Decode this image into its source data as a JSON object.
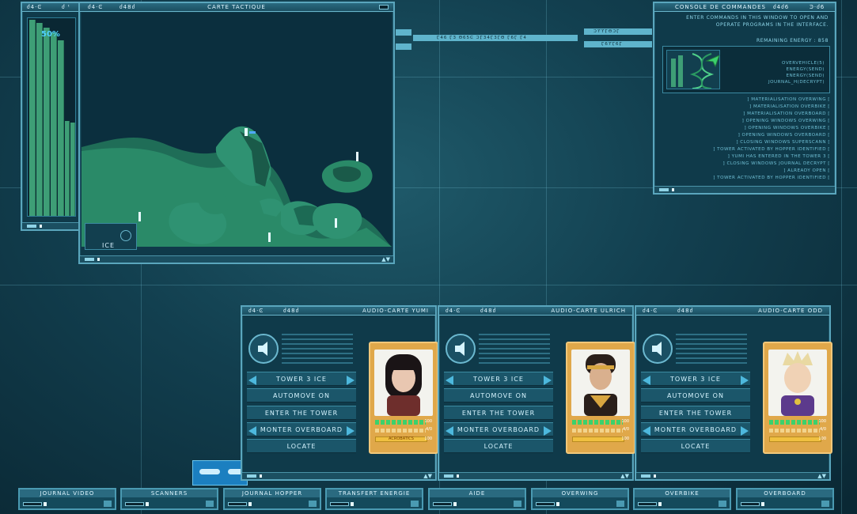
{
  "energy_panel": {
    "codes": [
      "ძ4·Ͼ",
      "ძ ᵗ"
    ],
    "energy_value": "50%",
    "energy_fraction": 0.5
  },
  "map": {
    "title": "CARTE TACTIQUE",
    "codes": [
      "ძ4·Ͼ",
      "ძ48ძ"
    ],
    "sector_label": "ICE"
  },
  "connector": {
    "center_label": "Ӷ46 Ӷ3 ϑ65Ͼ ϽӶ34Ӷ3Ӷϑ Ӷ6Ӷ Ӷ4",
    "right_top": "ϽϒϒӶϑϽӶ",
    "right_bottom": "Ӷ6ϒӶ6Ӷ"
  },
  "console": {
    "title": "CONSOLE DE COMMANDES",
    "codes": [
      "ძ4ძ6",
      "Ͽ·ძ6"
    ],
    "intro": "ENTER COMMANDS IN THIS WINDOW TO OPEN AND OPERATE PROGRAMS IN THE INTERFACE.",
    "intro_line1": "ENTER COMMANDS IN THIS WINDOW TO OPEN AND",
    "intro_line2": "OPERATE PROGRAMS IN THE INTERFACE.",
    "remaining_energy": "REMAINING ENERGY : 858",
    "programs": [
      "OVERVEHICLE(5)",
      "ENERGY(SEND)",
      "ENERGY(SEND)",
      "JOURNAL_H(DECRYPT)"
    ],
    "log": [
      "] MATERIALISATION OVERWING [",
      "] MATERIALISATION OVERBIKE [",
      "] MATERIALISATION OVERBOARD [",
      "] OPENING WINDOWS OVERWING [",
      "] OPENING WINDOWS OVERBIKE [",
      "] OPENING WINDOWS OVERBOARD [",
      "] CLOSING WINDOWS SUPERSCANN [",
      "] TOWER ACTIVATED BY HOPPER IDENTIFIED [",
      "] YUMI HAS ENTERED IN THE TOWER 3 [",
      "] CLOSING WINDOWS JOURNAL DECRYPT [",
      "] ALREADY OPEN [",
      "] TOWER ACTIVATED BY HOPPER IDENTIFIED ["
    ]
  },
  "cards": [
    {
      "title": "AUDIO-CARTE YUMI",
      "codes": [
        "ძ4·Ͼ",
        "ძ48ძ"
      ],
      "tower": "TOWER 3 ICE",
      "automove": "AUTOMOVE ON",
      "enter": "ENTER THE TOWER",
      "vehicle": "MONTER OVERBOARD",
      "locate": "LOCATE",
      "skill": "ACROBATICS",
      "stat_a": "100",
      "stat_b": "4/0",
      "stat_c": "100",
      "hair": "#1a1416",
      "skin": "#e9c7b1",
      "outfit": "#6e2e2c"
    },
    {
      "title": "AUDIO-CARTE ULRICH",
      "codes": [
        "ძ4·Ͼ",
        "ძ48ძ"
      ],
      "tower": "TOWER 3 ICE",
      "automove": "AUTOMOVE ON",
      "enter": "ENTER THE TOWER",
      "vehicle": "MONTER OVERBOARD",
      "locate": "LOCATE",
      "skill": "",
      "stat_a": "100",
      "stat_b": "4/0",
      "stat_c": "100",
      "hair": "#2a1f1a",
      "skin": "#d9b08e",
      "outfit": "#d8a640"
    },
    {
      "title": "AUDIO-CARTE ODD",
      "codes": [
        "ძ4·Ͼ",
        "ძ48ძ"
      ],
      "tower": "TOWER 3 ICE",
      "automove": "AUTOMOVE ON",
      "enter": "ENTER THE TOWER",
      "vehicle": "MONTER OVERBOARD",
      "locate": "LOCATE",
      "skill": "",
      "stat_a": "100",
      "stat_b": "4/0",
      "stat_c": "100",
      "hair": "#e9d9a2",
      "skin": "#f0d2b5",
      "outfit": "#5c3a8c"
    }
  ],
  "dock": [
    "JOURNAL VIDEO",
    "SCANNERS",
    "JOURNAL HOPPER",
    "TRANSFERT ENERGIE",
    "AIDE",
    "OVERWING",
    "OVERBIKE",
    "OVERBOARD"
  ],
  "colors": {
    "accent": "#5aa6bd",
    "background": "#123f4f",
    "energy_green": "#3e9e76",
    "portrait_frame": "#e0a84a"
  }
}
